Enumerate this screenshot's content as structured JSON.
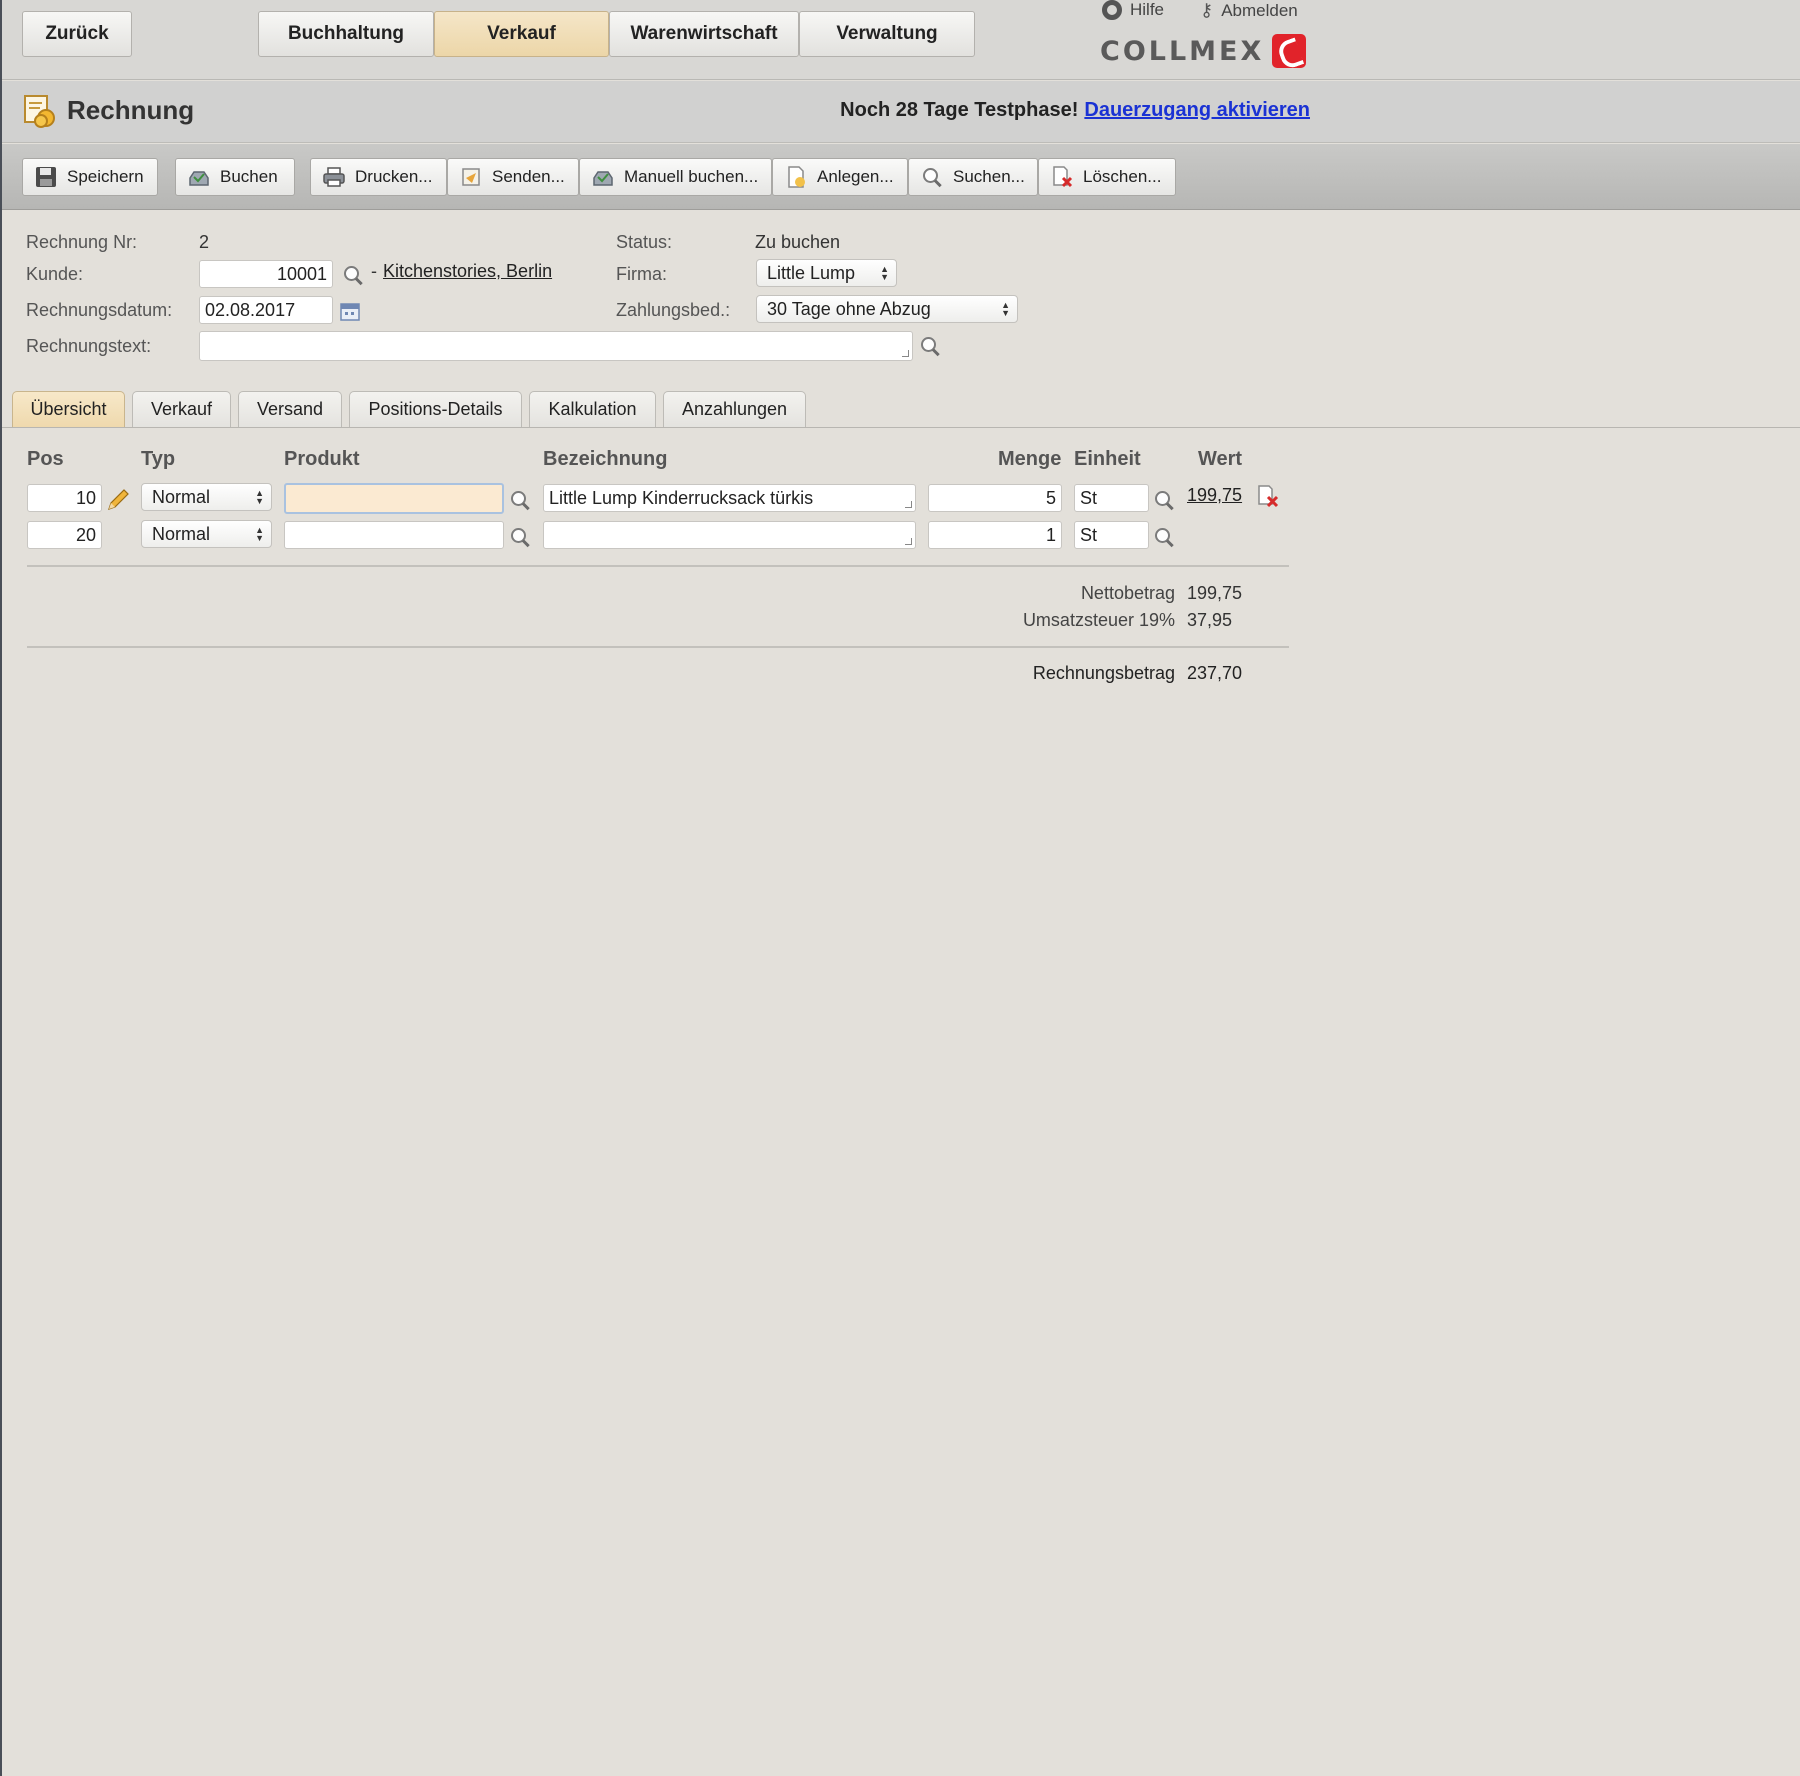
{
  "nav": {
    "back": "Zurück",
    "tabs": [
      "Buchhaltung",
      "Verkauf",
      "Warenwirtschaft",
      "Verwaltung"
    ],
    "active_tab": "Verkauf",
    "help": "Hilfe",
    "logout": "Abmelden",
    "logo_text": "COLLMEX"
  },
  "titlebar": {
    "title": "Rechnung",
    "trial_text": "Noch 28 Tage Testphase!",
    "trial_link": "Dauerzugang aktivieren"
  },
  "toolbar": {
    "save": "Speichern",
    "book": "Buchen",
    "print": "Drucken...",
    "send": "Senden...",
    "manual_book": "Manuell buchen...",
    "create": "Anlegen...",
    "search": "Suchen...",
    "delete": "Löschen..."
  },
  "form": {
    "invoice_no_label": "Rechnung Nr:",
    "invoice_no": "2",
    "customer_label": "Kunde:",
    "customer_no": "10001",
    "customer_sep": "-",
    "customer_name": "Kitchenstories, Berlin",
    "date_label": "Rechnungsdatum:",
    "date": "02.08.2017",
    "text_label": "Rechnungstext:",
    "text_value": "",
    "status_label": "Status:",
    "status": "Zu buchen",
    "company_label": "Firma:",
    "company": "Little Lump",
    "payment_label": "Zahlungsbed.:",
    "payment": "30 Tage ohne Abzug"
  },
  "tabs": [
    "Übersicht",
    "Verkauf",
    "Versand",
    "Positions-Details",
    "Kalkulation",
    "Anzahlungen"
  ],
  "active_tab": "Übersicht",
  "table": {
    "headers": {
      "pos": "Pos",
      "type": "Typ",
      "product": "Produkt",
      "description": "Bezeichnung",
      "quantity": "Menge",
      "unit": "Einheit",
      "value": "Wert"
    },
    "rows": [
      {
        "pos": "10",
        "type": "Normal",
        "product": "",
        "description": "Little Lump Kinderrucksack türkis",
        "quantity": "5",
        "unit": "St",
        "value": "199,75"
      },
      {
        "pos": "20",
        "type": "Normal",
        "product": "",
        "description": "",
        "quantity": "1",
        "unit": "St",
        "value": ""
      }
    ]
  },
  "totals": {
    "net_label": "Nettobetrag",
    "net": "199,75",
    "vat_label": "Umsatzsteuer 19%",
    "vat": "37,95",
    "total_label": "Rechnungsbetrag",
    "total": "237,70"
  },
  "colors": {
    "accent_tab": "#efd9ad",
    "link": "#1a32d4",
    "logo_red": "#e1232a",
    "product_input_active": "#fbead2"
  }
}
